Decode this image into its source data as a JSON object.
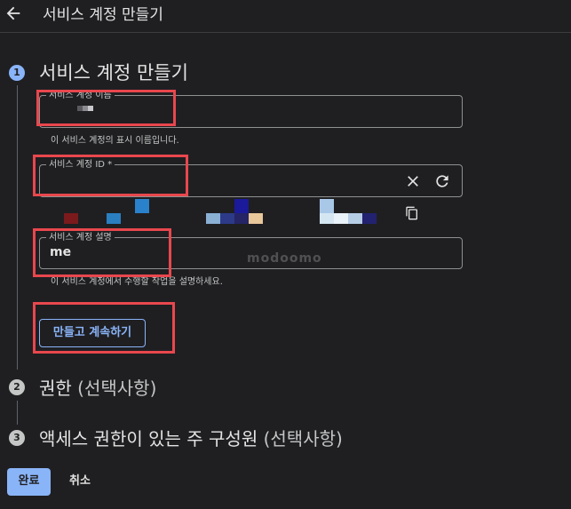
{
  "header": {
    "title": "서비스 계정 만들기"
  },
  "steps": [
    {
      "number": "1",
      "title": "서비스 계정 만들기",
      "optional": ""
    },
    {
      "number": "2",
      "title": "권한",
      "optional": "(선택사항)"
    },
    {
      "number": "3",
      "title": "액세스 권한이 있는 주 구성원",
      "optional": "(선택사항)"
    }
  ],
  "fields": {
    "name": {
      "label": "서비스 계정 이름",
      "helper": "이 서비스 계정의 표시 이름입니다."
    },
    "id": {
      "label": "서비스 계정 ID *"
    },
    "description": {
      "label": "서비스 계정 설명",
      "value": "me",
      "helper": "이 서비스 계정에서 수행할 작업을 설명하세요."
    }
  },
  "buttons": {
    "create_continue": "만들고 계속하기",
    "done": "완료",
    "cancel": "취소"
  },
  "watermark": "modoomo",
  "icons": [
    "arrow-back-icon",
    "clear-icon",
    "refresh-icon",
    "copy-icon"
  ],
  "colors": {
    "accent": "#8ab4f8",
    "highlight": "#e8474d",
    "background": "#1f1f22"
  }
}
